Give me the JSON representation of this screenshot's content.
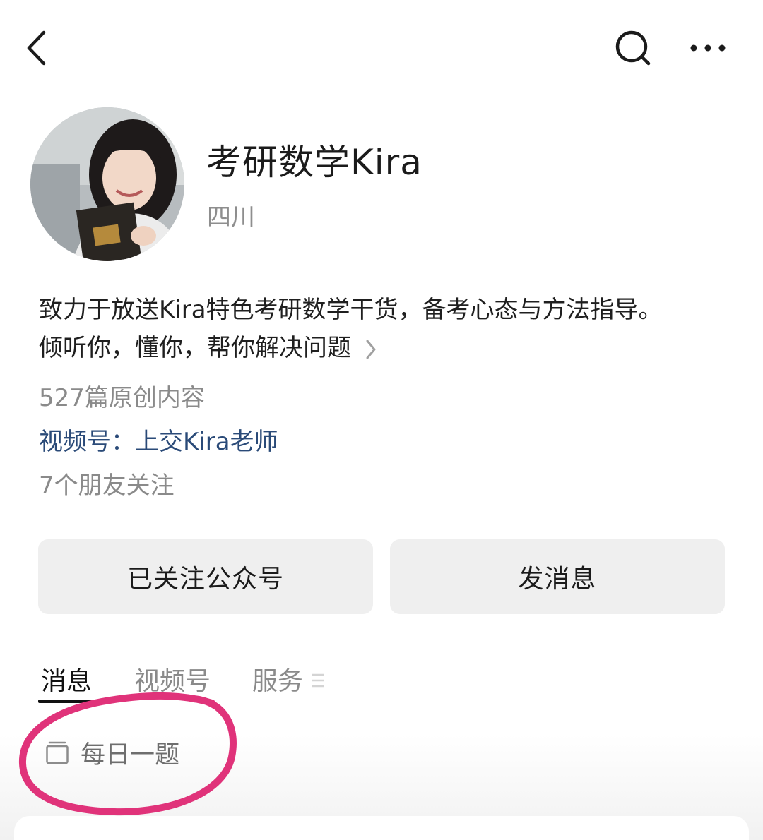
{
  "header": {
    "back_icon": "chevron-left-icon",
    "search_icon": "search-icon",
    "more_icon": "more-horizontal-icon"
  },
  "profile": {
    "name": "考研数学Kira",
    "region": "四川",
    "bio_line1": "致力于放送Kira特色考研数学干货，备考心态与方法指导。",
    "bio_line2": "倾听你，懂你，帮你解决问题",
    "originals": "527篇原创内容",
    "channel_label": "视频号：",
    "channel_name": "上交Kira老师",
    "friends_following": "7个朋友关注"
  },
  "actions": {
    "follow_label": "已关注公众号",
    "message_label": "发消息"
  },
  "tabs": [
    {
      "label": "消息",
      "active": true
    },
    {
      "label": "视频号",
      "active": false
    },
    {
      "label": "服务",
      "active": false
    }
  ],
  "series": {
    "icon": "folder-stack-icon",
    "label": "每日一题"
  },
  "colors": {
    "channel_link": "#2a4a78",
    "annotation_circle": "#e0337a",
    "button_bg": "#efefef"
  }
}
